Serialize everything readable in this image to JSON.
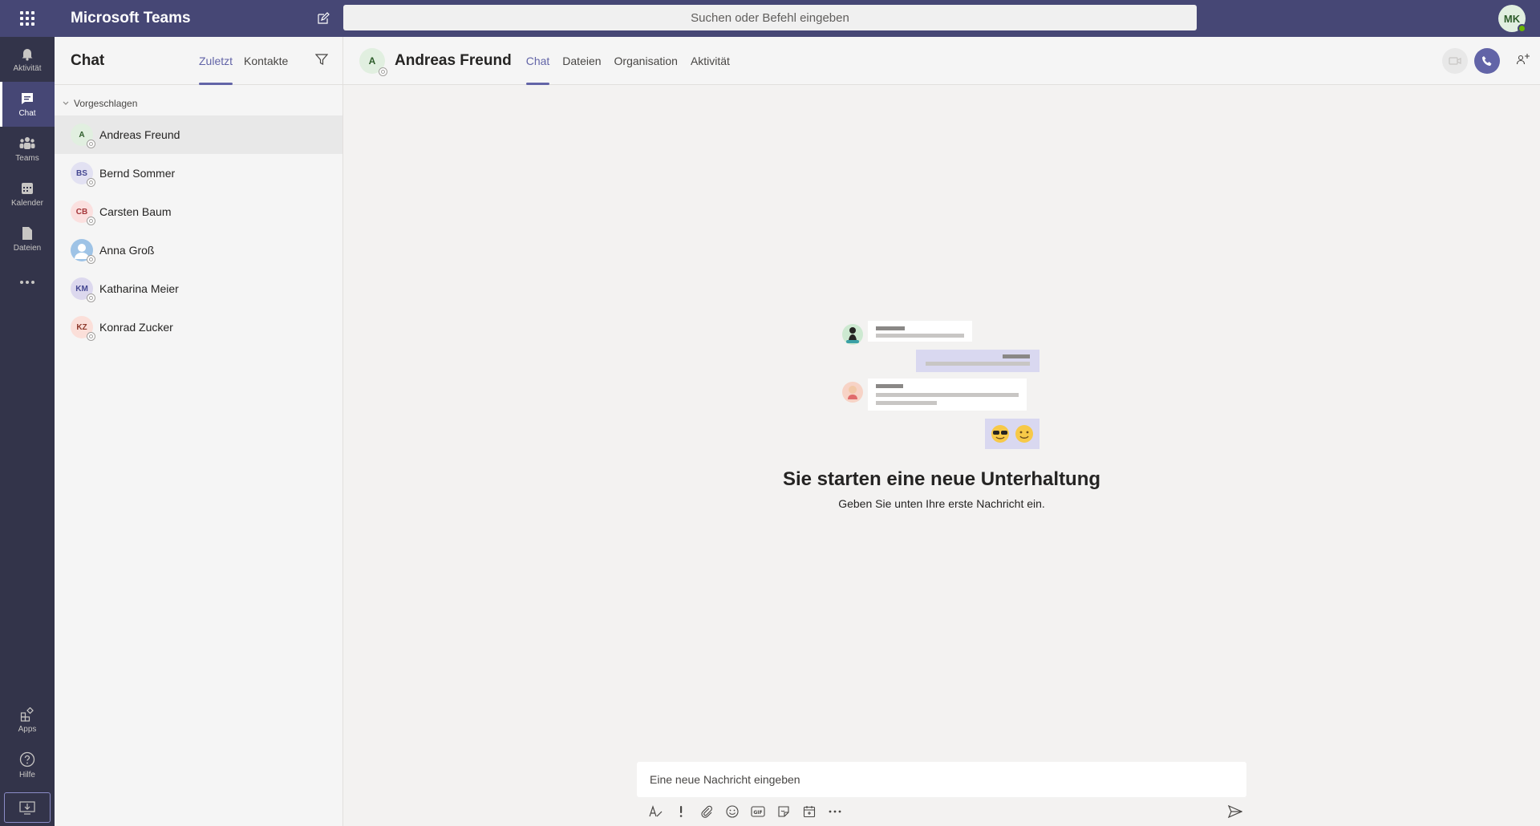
{
  "app": {
    "title": "Microsoft Teams",
    "user_initials": "MK"
  },
  "search": {
    "placeholder": "Suchen oder Befehl eingeben"
  },
  "rail": {
    "items": [
      {
        "label": "Aktivität",
        "icon": "bell-icon"
      },
      {
        "label": "Chat",
        "icon": "chat-icon",
        "active": true
      },
      {
        "label": "Teams",
        "icon": "teams-icon"
      },
      {
        "label": "Kalender",
        "icon": "calendar-icon"
      },
      {
        "label": "Dateien",
        "icon": "files-icon"
      }
    ],
    "bottom": [
      {
        "label": "Apps",
        "icon": "apps-icon"
      },
      {
        "label": "Hilfe",
        "icon": "help-icon"
      }
    ]
  },
  "chat_panel": {
    "title": "Chat",
    "tabs": [
      "Zuletzt",
      "Kontakte"
    ],
    "section": "Vorgeschlagen",
    "contacts": [
      {
        "initials": "A",
        "name": "Andreas Freund",
        "bg": "#e1efe0",
        "fg": "#2d5c2a"
      },
      {
        "initials": "BS",
        "name": "Bernd Sommer",
        "bg": "#e2e1f2",
        "fg": "#444791"
      },
      {
        "initials": "CB",
        "name": "Carsten Baum",
        "bg": "#fbe0df",
        "fg": "#a4373a"
      },
      {
        "initials": "",
        "name": "Anna Groß",
        "bg": "#9ec3e6",
        "fg": "#ffffff"
      },
      {
        "initials": "KM",
        "name": "Katharina Meier",
        "bg": "#dcd8ee",
        "fg": "#444791"
      },
      {
        "initials": "KZ",
        "name": "Konrad Zucker",
        "bg": "#fbdfd9",
        "fg": "#8e3a2c"
      }
    ]
  },
  "main": {
    "contact_initials": "A",
    "contact_name": "Andreas Freund",
    "tabs": [
      "Chat",
      "Dateien",
      "Organisation",
      "Aktivität"
    ],
    "empty_title": "Sie starten eine neue Unterhaltung",
    "empty_subtitle": "Geben Sie unten Ihre erste Nachricht ein.",
    "composer_placeholder": "Eine neue Nachricht eingeben"
  },
  "colors": {
    "brand": "#464775",
    "accent": "#6264a7",
    "rail": "#33344a"
  }
}
